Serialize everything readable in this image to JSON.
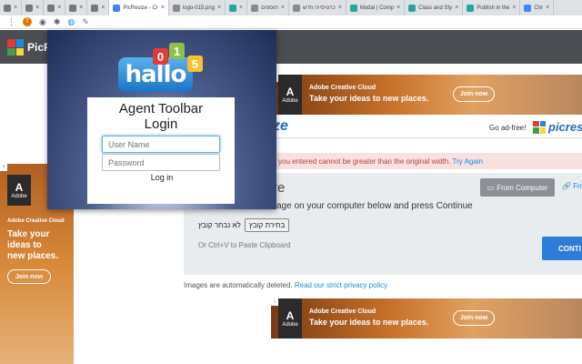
{
  "browser": {
    "tabs": [
      {
        "label": "",
        "color": "#777777"
      },
      {
        "label": "",
        "color": "#777777"
      },
      {
        "label": "",
        "color": "#777777"
      },
      {
        "label": "",
        "color": "#777777"
      },
      {
        "label": "",
        "color": "#777777"
      },
      {
        "label": "PicResize - Cr",
        "color": "#4285f4",
        "active": true
      },
      {
        "label": "logo-015.png",
        "color": "#8a8a8a"
      },
      {
        "label": "",
        "color": "#26a69a"
      },
      {
        "label": "תוספים",
        "color": "#8a8a8a"
      },
      {
        "label": "כרטיסייה חדש",
        "color": "#8a8a8a"
      },
      {
        "label": "Modal | Comp",
        "color": "#26a69a"
      },
      {
        "label": "Class and Sty",
        "color": "#26a69a"
      },
      {
        "label": "Publish in the",
        "color": "#26a69a"
      },
      {
        "label": "Chr",
        "color": "#4285f4"
      }
    ],
    "profile_initial": "T"
  },
  "site": {
    "name": "PicResize",
    "brand_short": "ze",
    "ad_free": "Go ad-free!",
    "logo_text": "picres"
  },
  "ads": {
    "top": {
      "brand": "Adobe",
      "title": "Adobe Creative Cloud",
      "tagline": "Take your ideas to new places.",
      "cta": "Join now"
    },
    "bottom": {
      "brand": "Adobe",
      "title": "Adobe Creative Cloud",
      "tagline": "Take your ideas to new places.",
      "cta": "Join now"
    },
    "left": {
      "brand": "Adobe",
      "title": "Adobe Creative Cloud",
      "tagline_lines": [
        "Take your",
        "ideas to",
        "new places."
      ],
      "cta": "Join now"
    }
  },
  "alert": {
    "text": "you entered cannot be greater than the original width.",
    "link": "Try Again"
  },
  "upload": {
    "heading": "re",
    "from_computer": "From Computer",
    "from_other": "Fro",
    "instruction": "age on your computer below and press Continue",
    "file_button": "בחירת קובץ",
    "file_status": "לא נבחר קובץ",
    "paste_hint": "Or Ctrl+V to Paste Clipboard",
    "continue": "CONTI"
  },
  "privacy": {
    "text": "Images are automatically deleted.",
    "link": "Read our strict privacy policy"
  },
  "popup": {
    "logo_word": "hallo",
    "logo_digits": [
      "0",
      "1",
      "5"
    ],
    "title_line1": "Agent Toolbar",
    "title_line2": "Login",
    "username_placeholder": "User Name",
    "password_placeholder": "Password",
    "login_button": "Log in"
  }
}
